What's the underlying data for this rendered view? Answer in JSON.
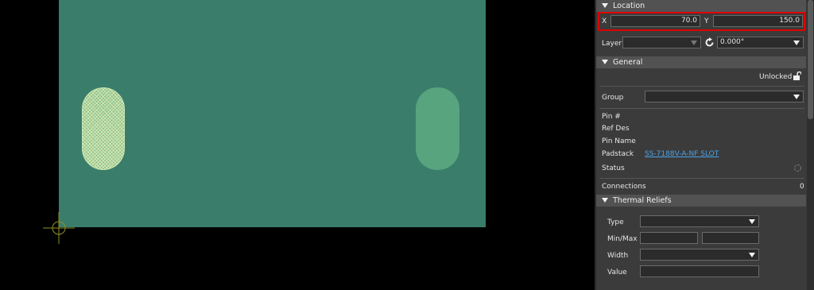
{
  "sections": {
    "location": "Location",
    "general": "General",
    "thermal": "Thermal Reliefs"
  },
  "location": {
    "x_label": "X",
    "x_value": "70.0",
    "y_label": "Y",
    "y_value": "150.0",
    "layer_label": "Layer",
    "layer_value": "",
    "rotation_value": "0.000°"
  },
  "general": {
    "lock_status": "Unlocked",
    "group_label": "Group",
    "group_value": "",
    "pin_number_label": "Pin #",
    "ref_des_label": "Ref Des",
    "pin_name_label": "Pin Name",
    "padstack_label": "Padstack",
    "padstack_value": "SS-7188V-A-NF SLOT",
    "status_label": "Status",
    "connections_label": "Connections",
    "connections_value": "0"
  },
  "thermal": {
    "type_label": "Type",
    "type_value": "",
    "minmax_label": "Min/Max",
    "min_value": "",
    "max_value": "",
    "width_label": "Width",
    "width_value": "",
    "value_label": "Value",
    "value_value": ""
  },
  "colors": {
    "board": "#3a7d6b",
    "pad_selected": "#8fc08f",
    "pad": "#57a47e",
    "highlight": "#e00000",
    "link": "#4aa3e8"
  },
  "icons": {
    "rotate": "rotate-icon",
    "lock": "unlock-icon",
    "status": "refresh-icon",
    "origin": "crosshair-icon"
  }
}
